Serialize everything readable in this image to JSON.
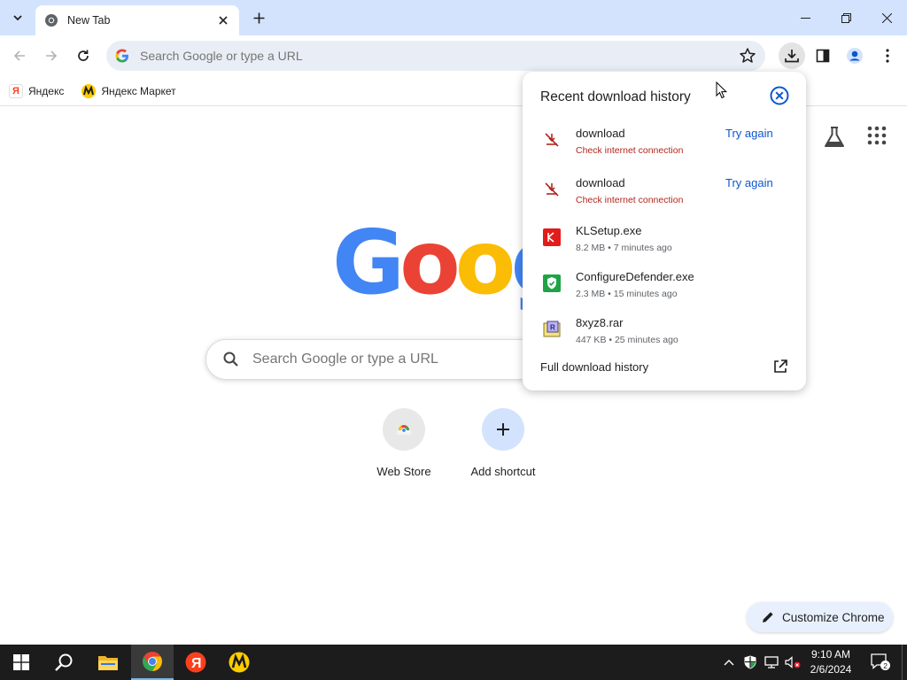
{
  "tabstrip": {
    "tab_title": "New Tab",
    "icons": {
      "tab_search": "chevron-down-icon",
      "favicon": "chrome-icon",
      "close": "close-icon",
      "new_tab": "plus-icon",
      "minimize": "minimize-icon",
      "restore": "restore-icon",
      "window_close": "close-icon"
    }
  },
  "toolbar": {
    "omnibox_placeholder": "Search Google or type a URL",
    "icons": [
      "back-icon",
      "forward-icon",
      "reload-icon",
      "google-icon",
      "star-icon",
      "download-icon",
      "side-panel-icon",
      "profile-icon",
      "menu-icon"
    ]
  },
  "bookmarks": [
    {
      "label": "Яндекс",
      "icon": "Я",
      "icon_color": "#fc3f1d"
    },
    {
      "label": "Яндекс Маркет",
      "icon": "М",
      "icon_color": "#ffcc00"
    }
  ],
  "ntp": {
    "logo_letters": [
      "G",
      "o",
      "o",
      "g"
    ],
    "logo_colors": [
      "#4285f4",
      "#ea4335",
      "#fbbc05",
      "#4285f4"
    ],
    "search_placeholder": "Search Google or type a URL",
    "shortcuts": [
      {
        "label": "Web Store",
        "icon": "chrome-web-store-icon"
      },
      {
        "label": "Add shortcut",
        "icon": "plus-icon"
      }
    ],
    "customize_label": "Customize Chrome"
  },
  "downloads": {
    "title": "Recent download history",
    "items": [
      {
        "name": "download",
        "status": "Check internet connection",
        "action": "Try again",
        "icon": "download-failed-icon"
      },
      {
        "name": "download",
        "status": "Check internet connection",
        "action": "Try again",
        "icon": "download-failed-icon"
      },
      {
        "name": "KLSetup.exe",
        "status": "8.2 MB • 7 minutes ago",
        "icon": "kaspersky-icon"
      },
      {
        "name": "ConfigureDefender.exe",
        "status": "2.3 MB • 15 minutes ago",
        "icon": "defender-shield-icon"
      },
      {
        "name": "8xyz8.rar",
        "status": "447 KB • 25 minutes ago",
        "icon": "rar-archive-icon"
      }
    ],
    "footer_label": "Full download history"
  },
  "taskbar": {
    "apps": [
      "windows-start-icon",
      "search-icon",
      "file-explorer-icon",
      "chrome-icon",
      "yandex-browser-icon",
      "yandex-market-icon"
    ],
    "time": "9:10 AM",
    "date": "2/6/2024",
    "notification_count": "2"
  },
  "colors": {
    "accent": "#0b57d0",
    "error": "#b3261e",
    "tabstrip_bg": "#d3e3fd",
    "omnibox_bg": "#e9eef6"
  }
}
